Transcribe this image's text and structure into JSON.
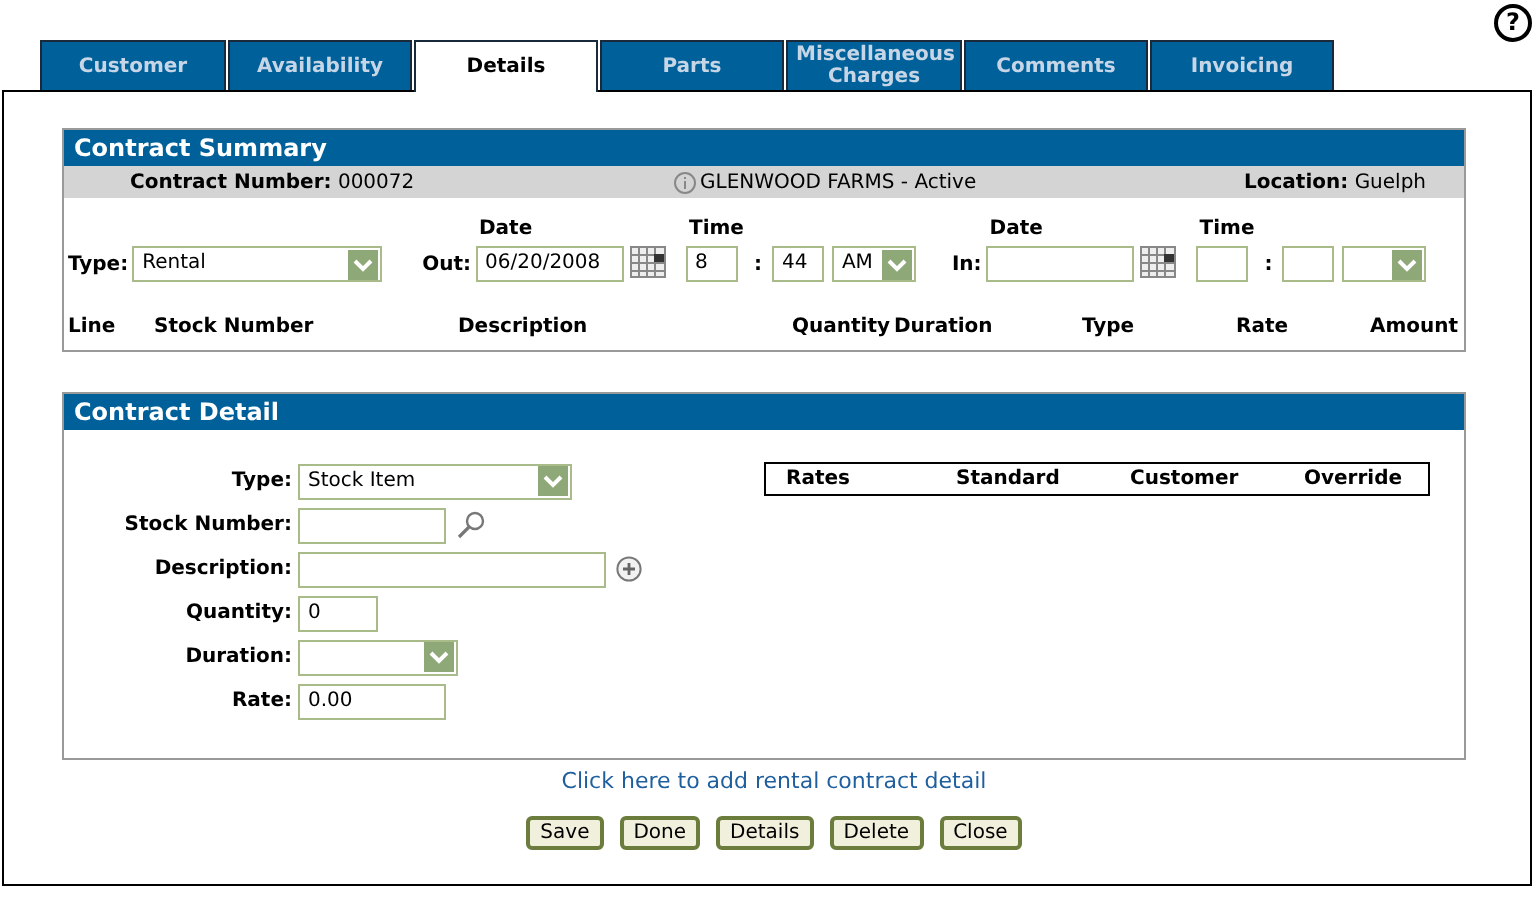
{
  "help": "?",
  "tabs": [
    {
      "label": "Customer",
      "selected": false
    },
    {
      "label": "Availability",
      "selected": false
    },
    {
      "label": "Details",
      "selected": true
    },
    {
      "label": "Parts",
      "selected": false
    },
    {
      "label": "Miscellaneous Charges",
      "selected": false
    },
    {
      "label": "Comments",
      "selected": false
    },
    {
      "label": "Invoicing",
      "selected": false
    }
  ],
  "contract_summary": {
    "title": "Contract Summary",
    "contract_number_label": "Contract Number:",
    "contract_number": "000072",
    "customer": "GLENWOOD FARMS - Active",
    "location_label": "Location:",
    "location": "Guelph",
    "type_label": "Type:",
    "type_value": "Rental",
    "out_label": "Out:",
    "out_date_header": "Date",
    "out_date": "06/20/2008",
    "out_time_header": "Time",
    "out_hour": "8",
    "time_separator_out": ":",
    "out_minute": "44",
    "out_ampm": "AM",
    "in_label": "In:",
    "in_date_header": "Date",
    "in_time_header": "Time",
    "time_separator_in": ":",
    "columns": [
      "Line",
      "Stock Number",
      "Description",
      "Quantity",
      "Duration",
      "Type",
      "Rate",
      "Amount"
    ]
  },
  "contract_detail": {
    "title": "Contract Detail",
    "fields": [
      {
        "label": "Type:",
        "kind": "select",
        "value": "Stock Item"
      },
      {
        "label": "Stock Number:",
        "kind": "lookup"
      },
      {
        "label": "Description:",
        "kind": "expandable"
      },
      {
        "label": "Quantity:",
        "kind": "text",
        "value": "0"
      },
      {
        "label": "Duration:",
        "kind": "select"
      },
      {
        "label": "Rate:",
        "kind": "text",
        "value": "0.00"
      }
    ],
    "rates_columns": [
      "Rates",
      "Standard",
      "Customer",
      "Override"
    ]
  },
  "add_link": "Click here to add rental contract detail",
  "buttons": [
    "Save",
    "Done",
    "Details",
    "Delete",
    "Close"
  ]
}
